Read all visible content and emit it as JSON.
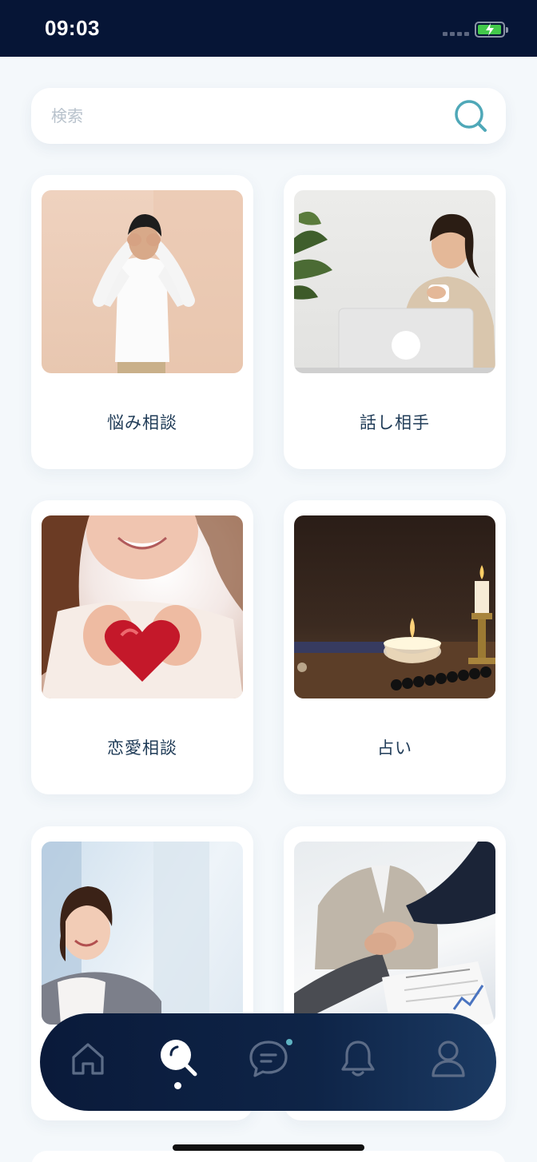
{
  "status": {
    "time": "09:03"
  },
  "search": {
    "placeholder": "検索"
  },
  "categories": [
    {
      "label": "悩み相談"
    },
    {
      "label": "話し相手"
    },
    {
      "label": "恋愛相談"
    },
    {
      "label": "占い"
    },
    {
      "label": ""
    },
    {
      "label": ""
    }
  ],
  "nav": {
    "items": [
      "home-icon",
      "search-icon",
      "chat-icon",
      "bell-icon",
      "user-icon"
    ],
    "active": "search-icon",
    "accent": "#5fb3c2"
  },
  "colors": {
    "header": "#061536",
    "accent": "#4fa8b8",
    "text": "#1f3b57"
  }
}
